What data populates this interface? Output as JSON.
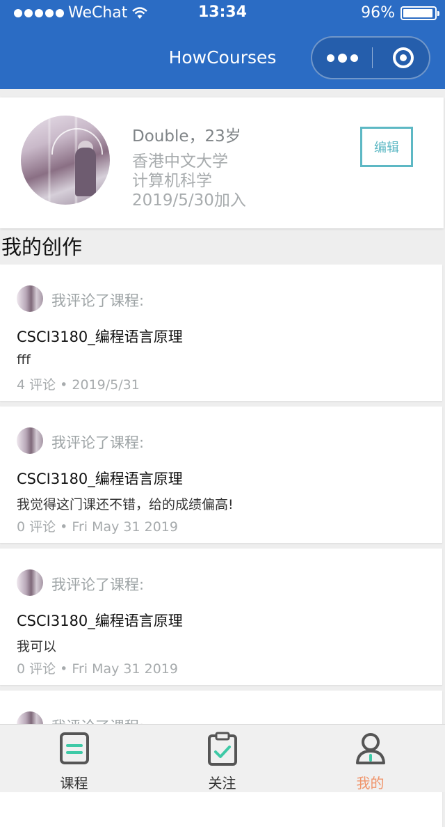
{
  "status_bar": {
    "carrier": "WeChat",
    "time": "13:34",
    "battery": "96%",
    "battery_level": 0.96
  },
  "nav": {
    "title": "HowCourses"
  },
  "profile": {
    "name_age": "Double，23岁",
    "university": "香港中文大学",
    "major": "计算机科学",
    "joined": "2019/5/30加入",
    "edit_label": "编辑"
  },
  "section_title": "我的创作",
  "posts": [
    {
      "action": "我评论了课程:",
      "course": "CSCI3180_编程语言原理",
      "content": "fff",
      "meta": "4 评论 • 2019/5/31"
    },
    {
      "action": "我评论了课程:",
      "course": "CSCI3180_编程语言原理",
      "content": "我觉得这门课还不错，给的成绩偏高!",
      "meta": "0 评论 • Fri May 31 2019"
    },
    {
      "action": "我评论了课程:",
      "course": "CSCI3180_编程语言原理",
      "content": "我可以",
      "meta": "0 评论 • Fri May 31 2019"
    },
    {
      "action": "我评论了课程:"
    }
  ],
  "tabs": [
    {
      "label": "课程",
      "icon": "course-doc-icon"
    },
    {
      "label": "关注",
      "icon": "clipboard-check-icon"
    },
    {
      "label": "我的",
      "icon": "person-icon",
      "active": true
    }
  ],
  "colors": {
    "nav": "#2b6cc4",
    "accent": "#5db8c4",
    "tab_active": "#f0946a",
    "check": "#3ec9a6"
  }
}
